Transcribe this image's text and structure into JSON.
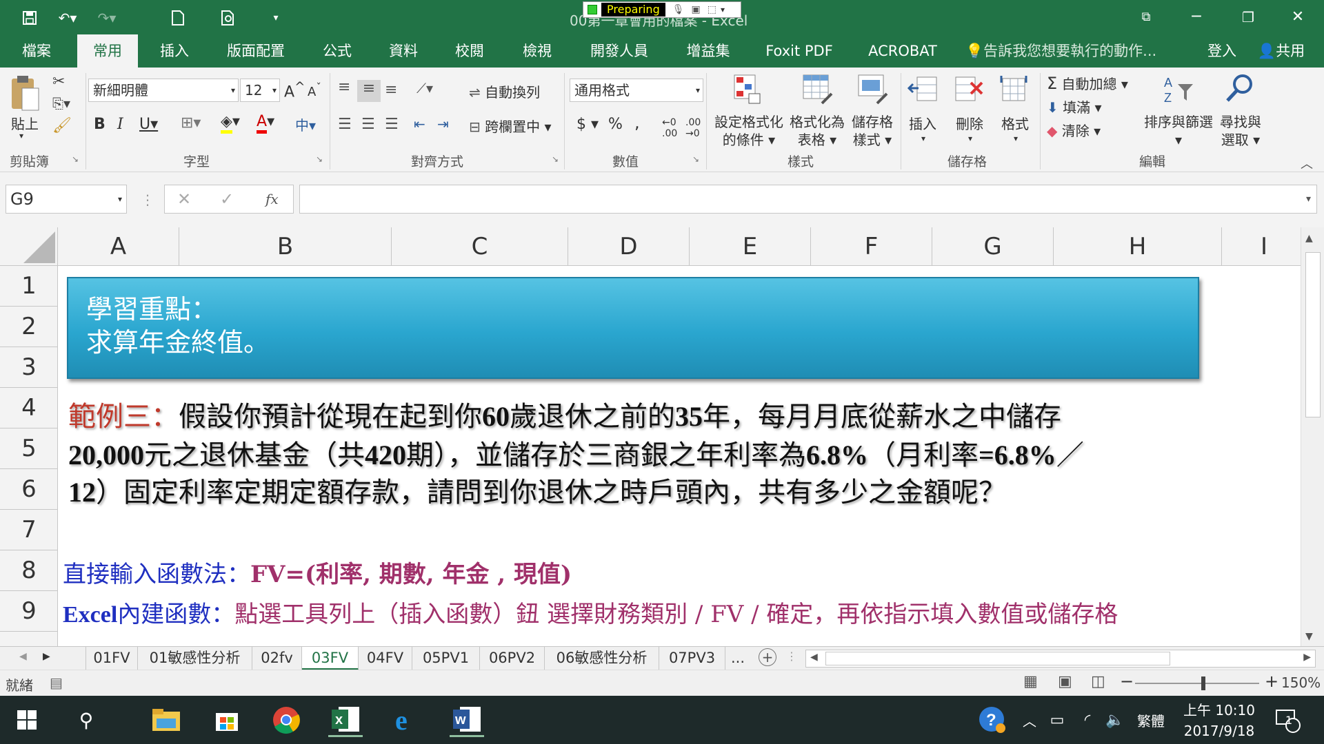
{
  "window": {
    "doc_title": "00第一章會用的檔案 - Excel",
    "preparing": "Preparing",
    "minimize_icon": "minimize-icon",
    "restore_icon": "restore-icon",
    "close_icon": "close-icon"
  },
  "tabs": [
    "檔案",
    "常用",
    "插入",
    "版面配置",
    "公式",
    "資料",
    "校閱",
    "檢視",
    "開發人員",
    "增益集",
    "Foxit PDF",
    "ACROBAT"
  ],
  "active_tab": "常用",
  "tell_me": "告訴我您想要執行的動作...",
  "sign_in": "登入",
  "share": "共用",
  "ribbon": {
    "paste": "貼上",
    "clipboard": "剪貼簿",
    "font_name": "新細明體",
    "font_size": "12",
    "font_group": "字型",
    "wrap_text": "自動換列",
    "merge_center": "跨欄置中",
    "alignment_group": "對齊方式",
    "number_format": "通用格式",
    "number_group": "數值",
    "cond_format_1": "設定格式化",
    "cond_format_2": "的條件",
    "format_table_1": "格式化為",
    "format_table_2": "表格",
    "cell_styles_1": "儲存格",
    "cell_styles_2": "樣式",
    "styles_group": "樣式",
    "insert": "插入",
    "delete": "刪除",
    "format": "格式",
    "cells_group": "儲存格",
    "autosum": "自動加總",
    "fill": "填滿",
    "clear": "清除",
    "sort_filter": "排序與篩選",
    "find_select_1": "尋找與",
    "find_select_2": "選取",
    "editing_group": "編輯"
  },
  "formula_bar": {
    "name_box": "G9",
    "fx": "fx",
    "formula": ""
  },
  "columns": [
    "A",
    "B",
    "C",
    "D",
    "E",
    "F",
    "G",
    "H",
    "I"
  ],
  "rows": [
    "1",
    "2",
    "3",
    "4",
    "5",
    "6",
    "7",
    "8",
    "9"
  ],
  "sheet": {
    "banner_line1": "學習重點：",
    "banner_line2": "求算年金終值。",
    "example_label": "範例三：",
    "p_line1_a": "假設你預計從現在起到你",
    "p_line1_b": "60",
    "p_line1_c": "歲退休之前的",
    "p_line1_d": "35",
    "p_line1_e": "年，每月月底從薪水之中儲存",
    "p_line2_a": "20,000",
    "p_line2_b": "元之退休基金（共",
    "p_line2_c": "420",
    "p_line2_d": "期），並儲存於三商銀之年利率為",
    "p_line2_e": "6.8%",
    "p_line2_f": "（月利率",
    "p_line2_g": "=6.8%",
    "p_line2_h": "／",
    "p_line3_a": "12",
    "p_line3_b": "）固定利率定期定額存款，請問到你退休之時戶頭內，共有多少之金額呢？",
    "line8_label": "直接輸入函數法：",
    "line8_formula": "FV=(利率, 期數, 年金 , 現值)",
    "line9_label_a": "Excel",
    "line9_label_b": "內建函數：",
    "line9_text": "點選工具列上（插入函數）鈕 選擇財務類別 / FV / 確定，再依指示填入數值或儲存格"
  },
  "sheet_tabs": [
    "01FV",
    "01敏感性分析",
    "02fv",
    "03FV",
    "04FV",
    "05PV1",
    "06PV2",
    "06敏感性分析",
    "07PV3"
  ],
  "active_sheet": "03FV",
  "more_tabs": "...",
  "status": {
    "ready": "就緒",
    "zoom": "150%"
  },
  "taskbar": {
    "ime": "繁體",
    "time": "上午 10:10",
    "date": "2017/9/18",
    "notification_count": "1"
  }
}
